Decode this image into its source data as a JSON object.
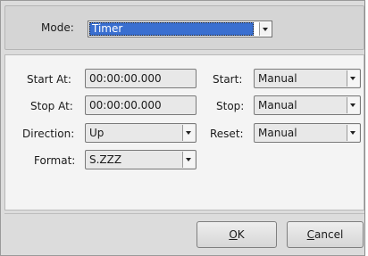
{
  "mode": {
    "label": "Mode:",
    "value": "Timer"
  },
  "fields": {
    "start_at": {
      "label": "Start At:",
      "value": "00:00:00.000"
    },
    "stop_at": {
      "label": "Stop At:",
      "value": "00:00:00.000"
    },
    "direction": {
      "label": "Direction:",
      "value": "Up"
    },
    "format": {
      "label": "Format:",
      "value": "S.ZZZ"
    },
    "start": {
      "label": "Start:",
      "value": "Manual"
    },
    "stop": {
      "label": "Stop:",
      "value": "Manual"
    },
    "reset": {
      "label": "Reset:",
      "value": "Manual"
    }
  },
  "buttons": {
    "ok": {
      "mnemonic": "O",
      "rest": "K"
    },
    "cancel": {
      "mnemonic": "C",
      "rest": "ancel"
    }
  },
  "colors": {
    "selection": "#3a6fd0",
    "dialog_bg": "#dcdcdc",
    "panel_bg": "#f4f4f4"
  },
  "icons": {
    "dropdown": "chevron-down-icon"
  }
}
